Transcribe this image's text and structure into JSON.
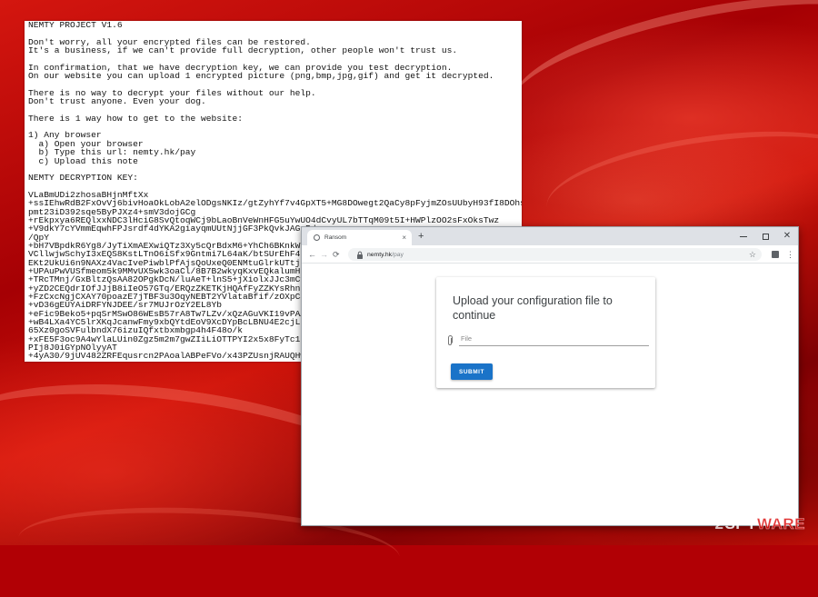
{
  "ransom_note": {
    "text": "NEMTY PROJECT V1.6\n\nDon't worry, all your encrypted files can be restored.\nIt's a business, if we can't provide full decryption, other people won't trust us.\n\nIn confirmation, that we have decryption key, we can provide you test decryption.\nOn our website you can upload 1 encrypted picture (png,bmp,jpg,gif) and get it decrypted.\n\nThere is no way to decrypt your files without our help.\nDon't trust anyone. Even your dog.\n\nThere is 1 way how to get to the website:\n\n1) Any browser\n  a) Open your browser\n  b) Type this url: nemty.hk/pay\n  c) Upload this note\n\nNEMTY DECRYPTION KEY:\n\nVLaBmUDi2zhosaBHjnMftXx\n+ssIEhwRdB2FxOvVj6bivHoaOkLobA2elODgsNKIz/gtZyhYf7v4GpXT5+MG8DOwegt2QaCy8pFyjmZOsUUbyH93fI8DOhskQLSh\npmt23iD392sqe5ByPJXz4+smV3dojGCg\n+rEkpxya6REQlxxNDC3lHciG8SvQtoqWCj9bLaoBnVeWnHFG5uYwUO4dCvyUL7bTTqM09t5I+HWPlzOO2sFxOksTwz\n+V9dkY7cYVmmEqwhFPJsrdf4dYKA2giayqmUUtNjjGF3PkQvkJAGyRda\n/QpY\n+bH7VBpdkR6Yg8/JyTiXmAEXwiQTz3Xy5cQrBdxM6+YhCh6BKnkW0fkc\nVCllwjwSchyI3xEQS8KstLTnO6iSfx9Gntmi7L64aK/btSUrEhF4ll6z\nEKt2UkUi6n9NAXz4VacIvePiwblPfAjsQoUxeQ0ENMtuGlrkUTtjiFQO\n+UPAuPwVUSfmeom5k9MMvUX5wk3oaCl/8B7B2wkyqKxvEQkalumH2xPi\n+TRcTMnj/GxBltzQsAA82OPgkDcN/luAeT+lnS5+jXiolxJJc3mCyLO\n+yZD2CEQdrIOfJJjB8iIeO57GTq/ERQzZKETKjHQAfFyZZKYsRhn/A9\n+FzCxcNgjCXAY70poazE7jTBF3u3OqyNEBT2YVlataBfif/zOXpCSv2Z\n+vD36gEUYAiDRFYNJDEE/sr7MUJrOzY2EL8Yb\n+eFic9Beko5+pqSrMSwO86WEsB57rA8Tw7LZv/xQzAGuVKI19vPAADna\n+wB4LXa4YC5lrXKqJcanwFmy9xbQYtdEoV9XcDYpBcLBNU4E2cjLE8uX\n65Xz0goSVFulbndX76izuIQfxtbxmbgp4h4F48o/k\n+xFE5F3oc9A4wYlaLUin0Zgz5m2m7gwZIiLiOTTPYI2x5x8FyTc135wY\nPIj8J0iGYpNOlyyAT\n+4yA30/9jUV482ZRFEqusrcn2PAoalABPeFVo/x43PZUsnjRAUQHw==X"
  },
  "browser": {
    "tab_title": "Ransom",
    "tab_close": "×",
    "new_tab": "+",
    "url_host": "nemty.hk",
    "url_path": "/pay",
    "nav_back": "←",
    "nav_forward": "→",
    "nav_reload": "⟳",
    "star": "☆",
    "menu": "⋮",
    "win_close": "✕"
  },
  "upload_card": {
    "title": "Upload your configuration file to continue",
    "file_placeholder": "File",
    "submit_label": "SUBMIT"
  },
  "watermark": {
    "prefix": "2",
    "spy": "SPY",
    "ware": "WARE"
  },
  "colors": {
    "submit_blue": "#1a73c8",
    "wallpaper_red": "#b10005",
    "tabstrip_gray": "#dee1e6"
  }
}
